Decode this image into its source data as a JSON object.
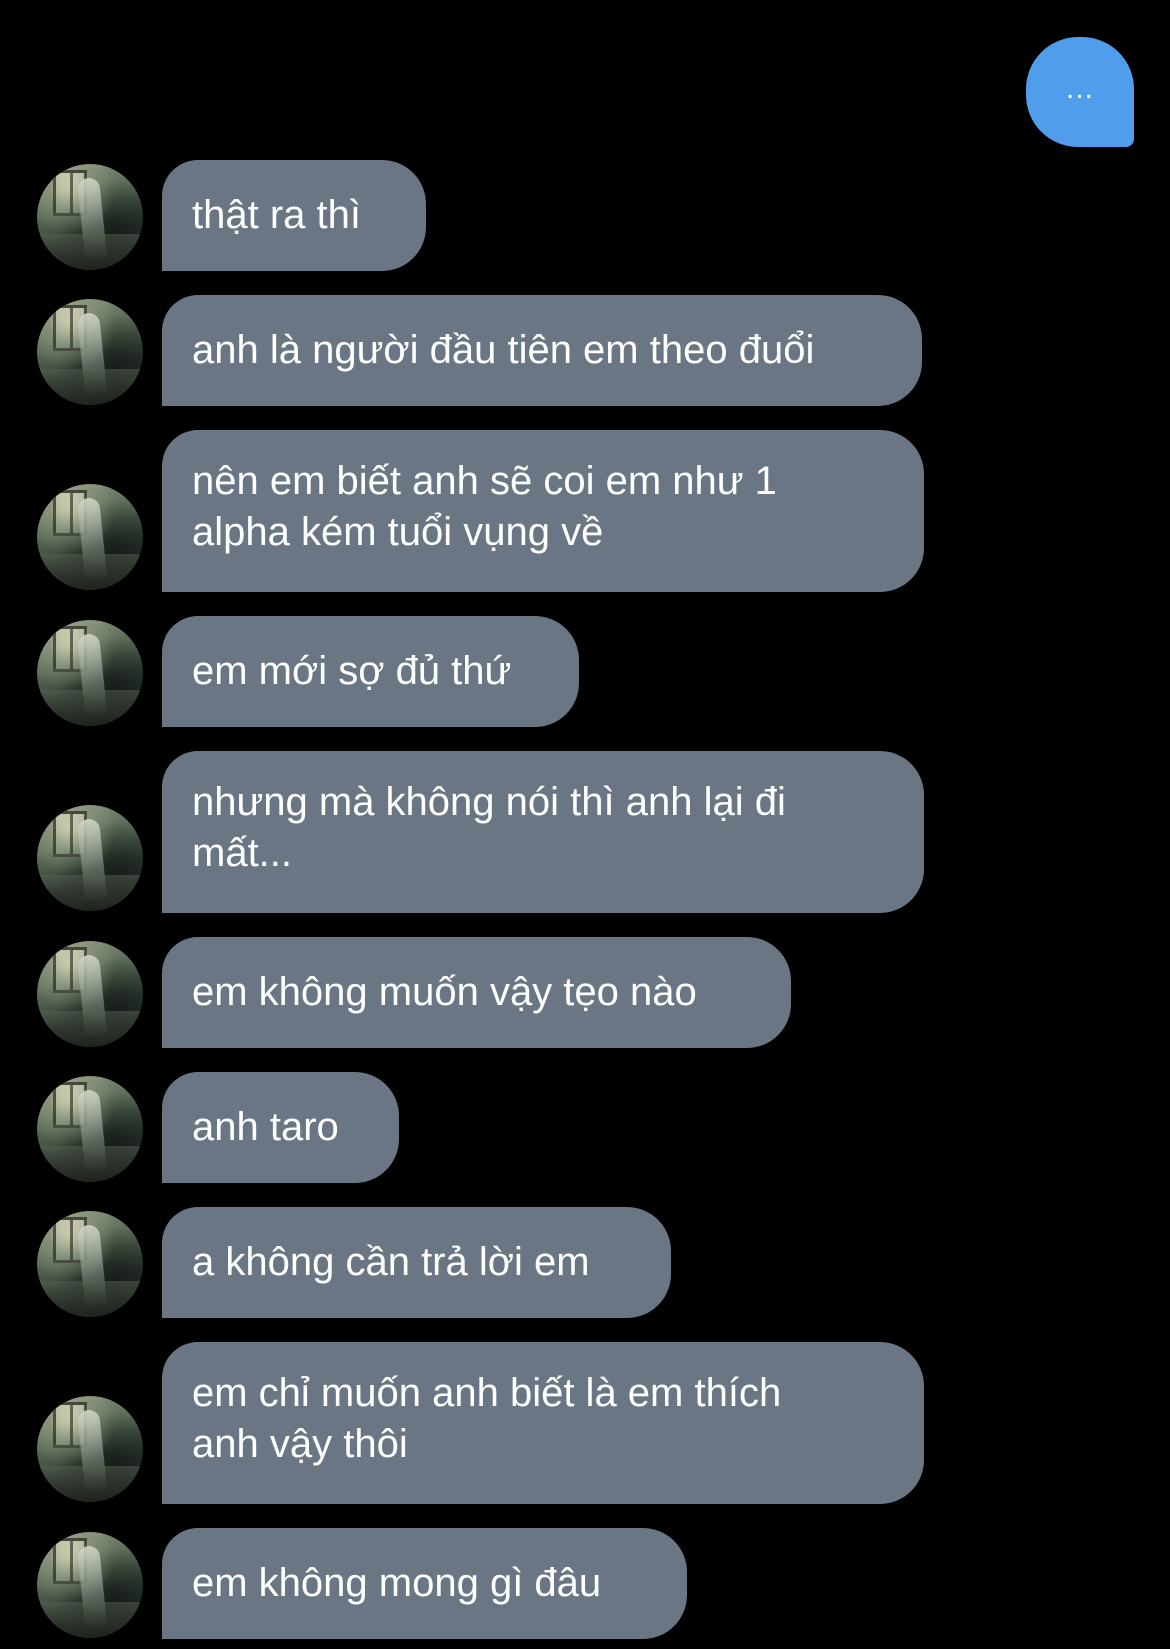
{
  "outgoing": {
    "text": "..."
  },
  "messages": [
    {
      "text": "thật ra thì"
    },
    {
      "text": "anh là người đầu tiên em theo đuổi"
    },
    {
      "text": "nên em biết anh sẽ coi em như 1 alpha kém tuổi vụng về"
    },
    {
      "text": "em mới sợ đủ thứ"
    },
    {
      "text": "nhưng mà không nói thì anh lại đi mất..."
    },
    {
      "text": "em không muốn vậy tẹo nào"
    },
    {
      "text": "anh taro"
    },
    {
      "text": "a không cần trả lời em"
    },
    {
      "text": "em chỉ muốn anh biết là em thích anh vậy thôi"
    },
    {
      "text": "em không mong gì đâu"
    }
  ],
  "colors": {
    "background": "#000000",
    "incoming_bubble": "#6a7684",
    "outgoing_bubble": "#4f9deb",
    "text": "#ffffff"
  },
  "icons": {
    "avatar": "contact-avatar-image"
  }
}
